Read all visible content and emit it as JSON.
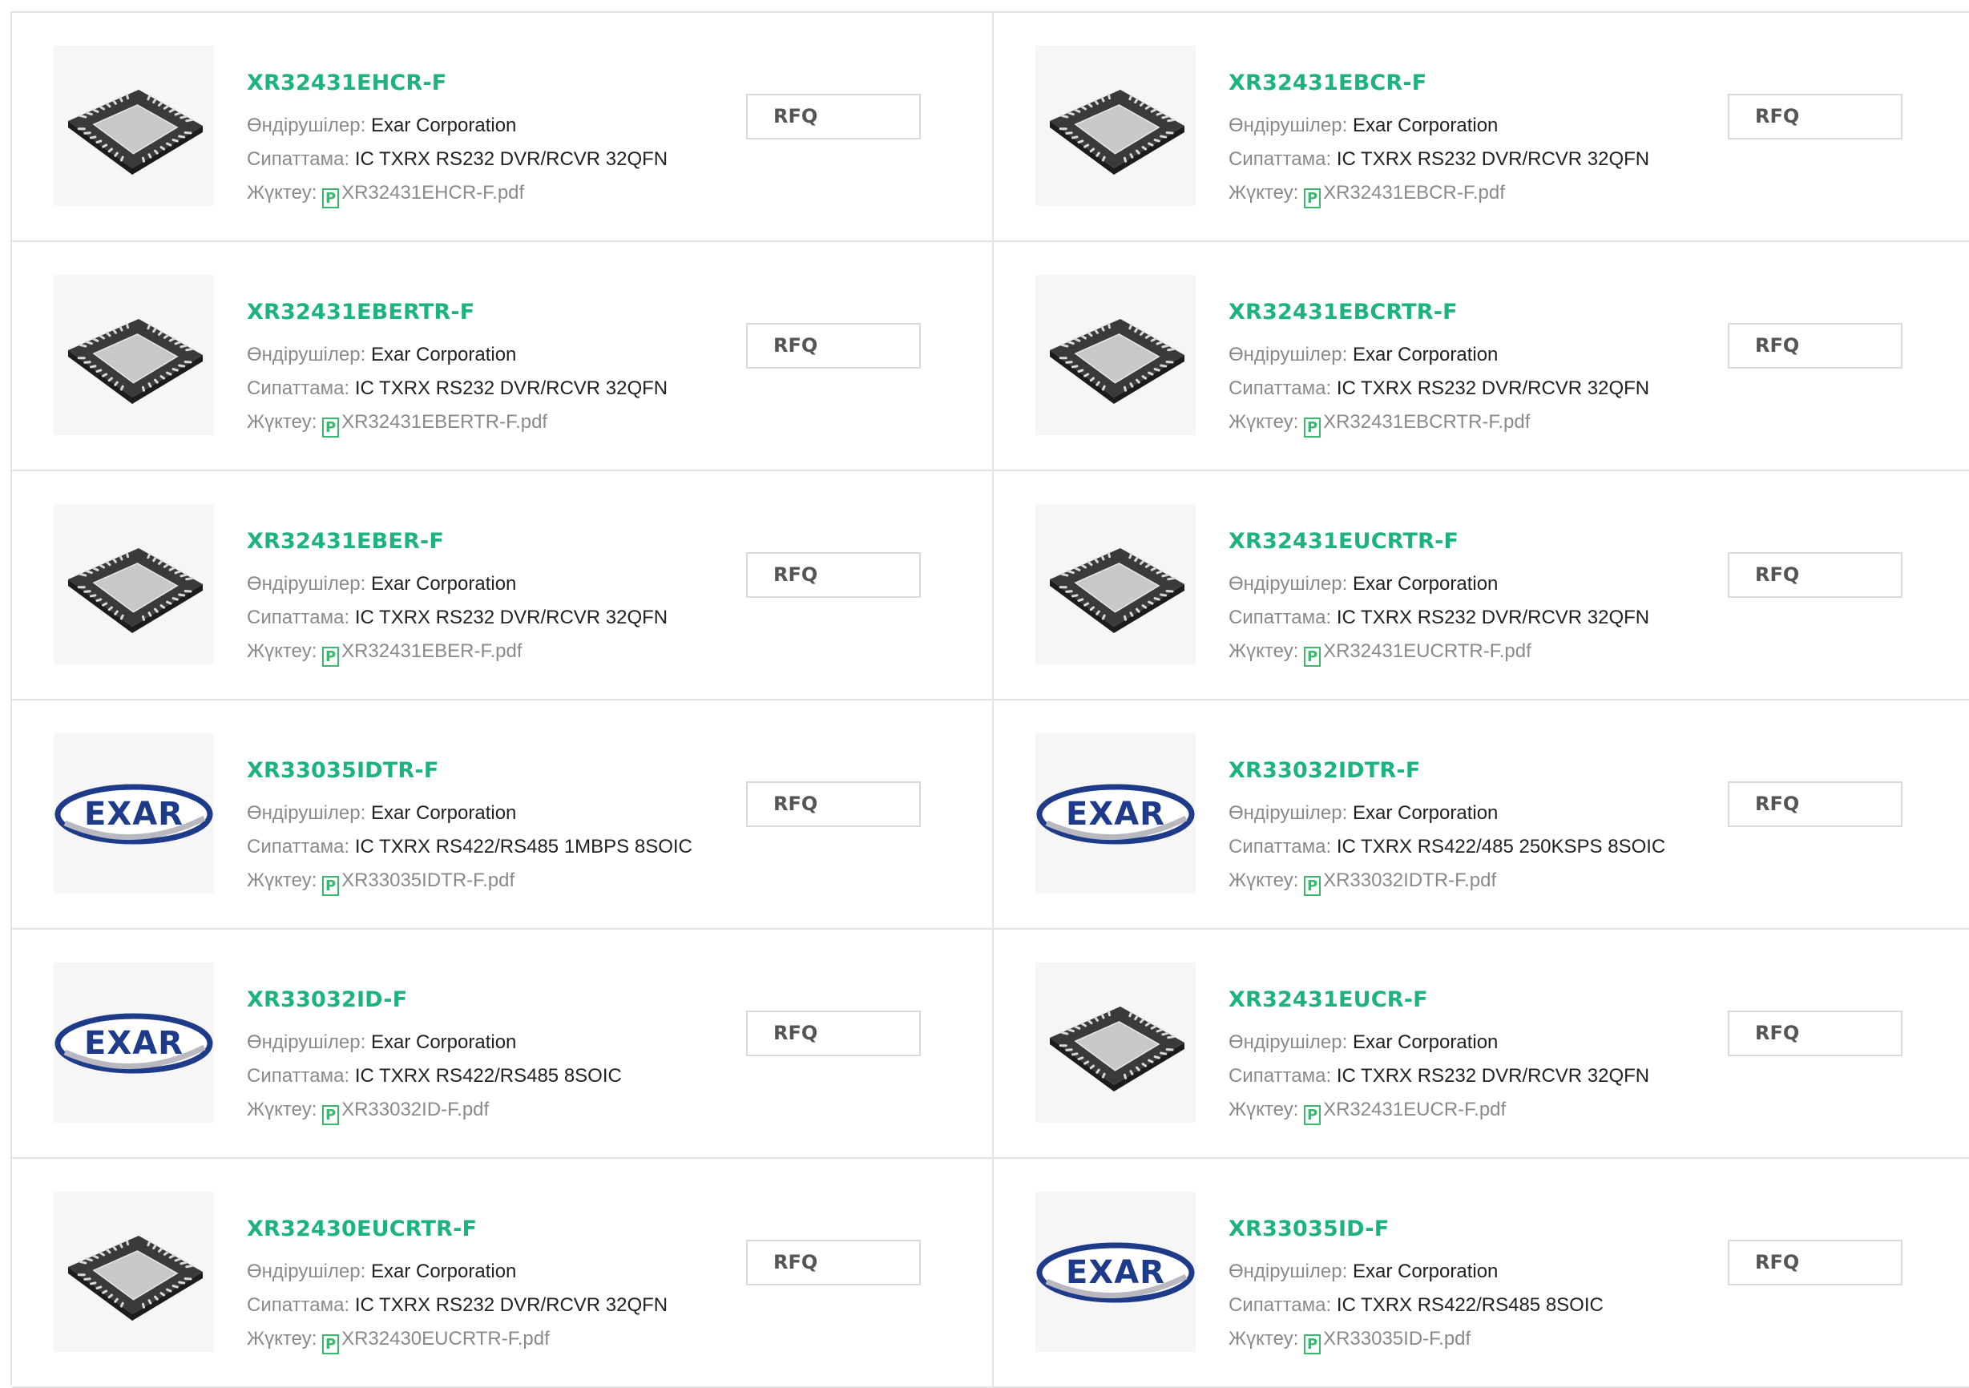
{
  "labels": {
    "manufacturer": "Өндірушілер:",
    "description": "Сипаттама:",
    "download": "Жүктеу:",
    "rfq": "RFQ",
    "pdf_glyph": "P"
  },
  "colors": {
    "part_number": "#1db37f",
    "label": "#8a8a8a",
    "value": "#222222",
    "pdf_icon": "#39b86e",
    "border": "#e3e3e3"
  },
  "products": [
    {
      "part": "XR32431EHCR-F",
      "manufacturer": "Exar Corporation",
      "description": "IC TXRX RS232 DVR/RCVR 32QFN",
      "pdf": "XR32431EHCR-F.pdf",
      "image": "qfn-chip"
    },
    {
      "part": "XR32431EBCR-F",
      "manufacturer": "Exar Corporation",
      "description": "IC TXRX RS232 DVR/RCVR 32QFN",
      "pdf": "XR32431EBCR-F.pdf",
      "image": "qfn-chip"
    },
    {
      "part": "XR32431EBERTR-F",
      "manufacturer": "Exar Corporation",
      "description": "IC TXRX RS232 DVR/RCVR 32QFN",
      "pdf": "XR32431EBERTR-F.pdf",
      "image": "qfn-chip"
    },
    {
      "part": "XR32431EBCRTR-F",
      "manufacturer": "Exar Corporation",
      "description": "IC TXRX RS232 DVR/RCVR 32QFN",
      "pdf": "XR32431EBCRTR-F.pdf",
      "image": "qfn-chip"
    },
    {
      "part": "XR32431EBER-F",
      "manufacturer": "Exar Corporation",
      "description": "IC TXRX RS232 DVR/RCVR 32QFN",
      "pdf": "XR32431EBER-F.pdf",
      "image": "qfn-chip"
    },
    {
      "part": "XR32431EUCRTR-F",
      "manufacturer": "Exar Corporation",
      "description": "IC TXRX RS232 DVR/RCVR 32QFN",
      "pdf": "XR32431EUCRTR-F.pdf",
      "image": "qfn-chip"
    },
    {
      "part": "XR33035IDTR-F",
      "manufacturer": "Exar Corporation",
      "description": "IC TXRX RS422/RS485 1MBPS 8SOIC",
      "pdf": "XR33035IDTR-F.pdf",
      "image": "exar-logo",
      "logo_text": "EXAR"
    },
    {
      "part": "XR33032IDTR-F",
      "manufacturer": "Exar Corporation",
      "description": "IC TXRX RS422/485 250KSPS 8SOIC",
      "pdf": "XR33032IDTR-F.pdf",
      "image": "exar-logo",
      "logo_text": "EXAR"
    },
    {
      "part": "XR33032ID-F",
      "manufacturer": "Exar Corporation",
      "description": "IC TXRX RS422/RS485 8SOIC",
      "pdf": "XR33032ID-F.pdf",
      "image": "exar-logo",
      "logo_text": "EXAR"
    },
    {
      "part": "XR32431EUCR-F",
      "manufacturer": "Exar Corporation",
      "description": "IC TXRX RS232 DVR/RCVR 32QFN",
      "pdf": "XR32431EUCR-F.pdf",
      "image": "qfn-chip"
    },
    {
      "part": "XR32430EUCRTR-F",
      "manufacturer": "Exar Corporation",
      "description": "IC TXRX RS232 DVR/RCVR 32QFN",
      "pdf": "XR32430EUCRTR-F.pdf",
      "image": "qfn-chip"
    },
    {
      "part": "XR33035ID-F",
      "manufacturer": "Exar Corporation",
      "description": "IC TXRX RS422/RS485 8SOIC",
      "pdf": "XR33035ID-F.pdf",
      "image": "exar-logo",
      "logo_text": "EXAR"
    }
  ]
}
